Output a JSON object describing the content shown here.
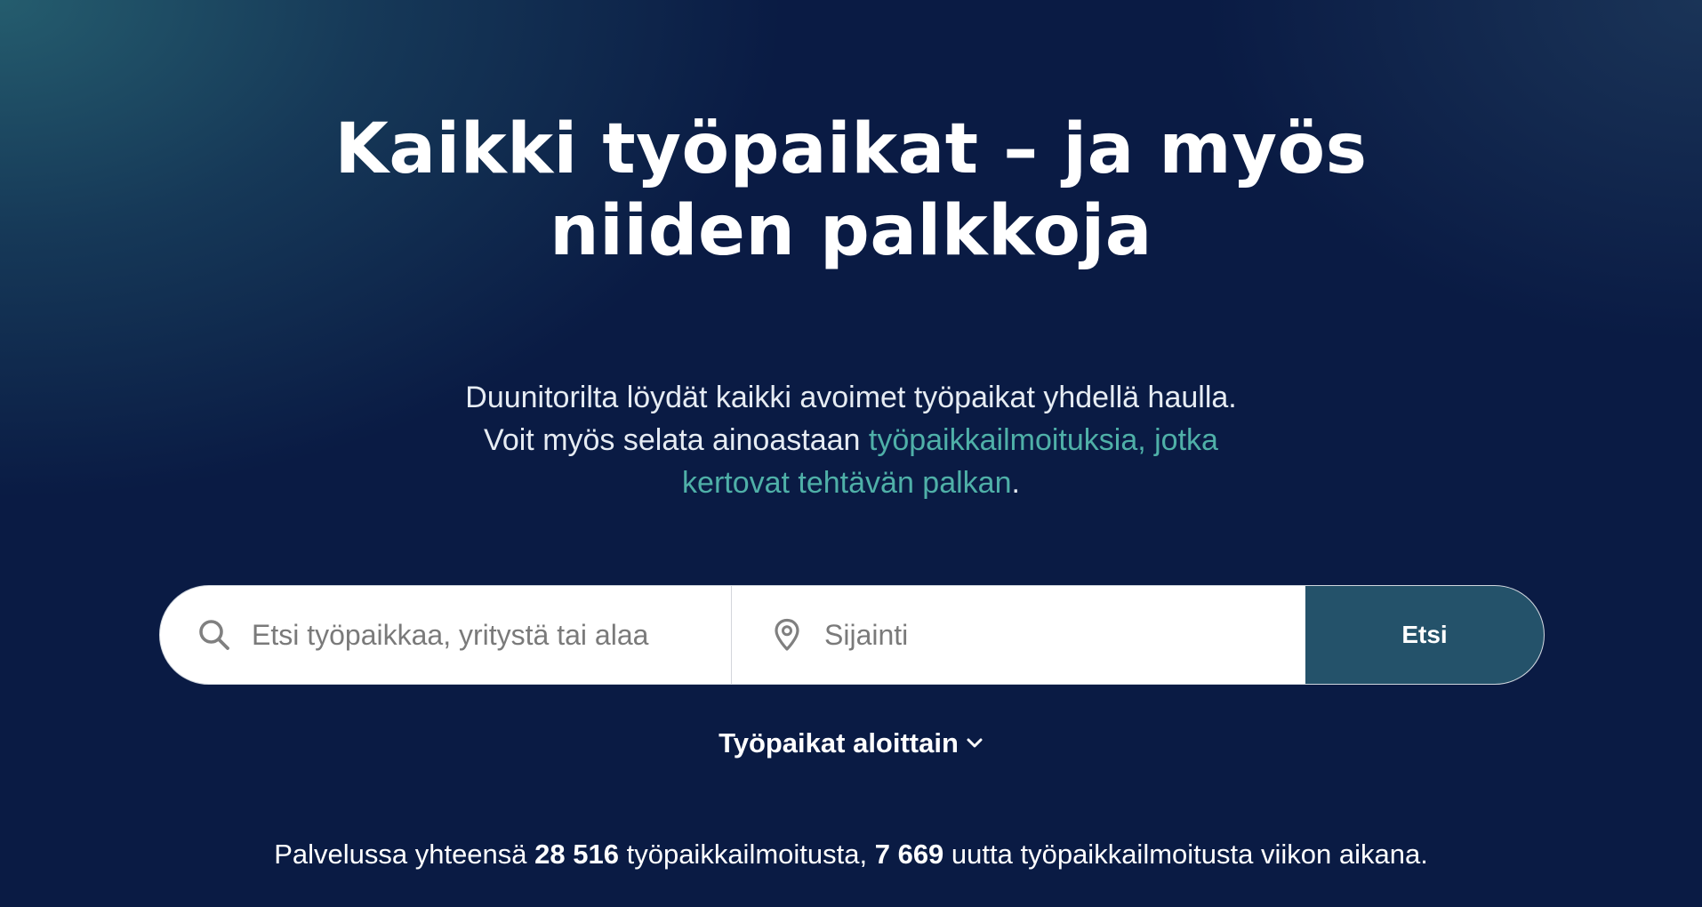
{
  "hero": {
    "headline_line1": "Kaikki työpaikat – ja myös",
    "headline_line2": "niiden palkkoja",
    "intro_line1": "Duunitorilta löydät kaikki avoimet työpaikat yhdellä haulla.",
    "intro_line2_text": "Voit myös selata ainoastaan ",
    "intro_link_part1": "työpaikkailmoituksia, jotka",
    "intro_link_part2": "kertovat tehtävän palkan",
    "intro_end": ".",
    "link_color": "#4fb0a8"
  },
  "search": {
    "keyword_placeholder": "Etsi työpaikkaa, yritystä tai alaa",
    "keyword_value": "",
    "keyword_icon": "search-icon",
    "location_placeholder": "Sijainti",
    "location_value": "",
    "location_icon": "map-pin-icon",
    "button_label": "Etsi",
    "button_color": "#24526a"
  },
  "browse": {
    "label": "Työpaikat aloittain",
    "icon": "chevron-down-icon"
  },
  "stats": {
    "prefix": "Palvelussa yhteensä ",
    "total_count": "28 516",
    "middle": " työpaikkailmoitusta, ",
    "new_count": "7 669",
    "suffix": " uutta työpaikkailmoitusta viikon aikana."
  },
  "colors": {
    "background": "#0a1b44",
    "background_glow": "#266070"
  }
}
